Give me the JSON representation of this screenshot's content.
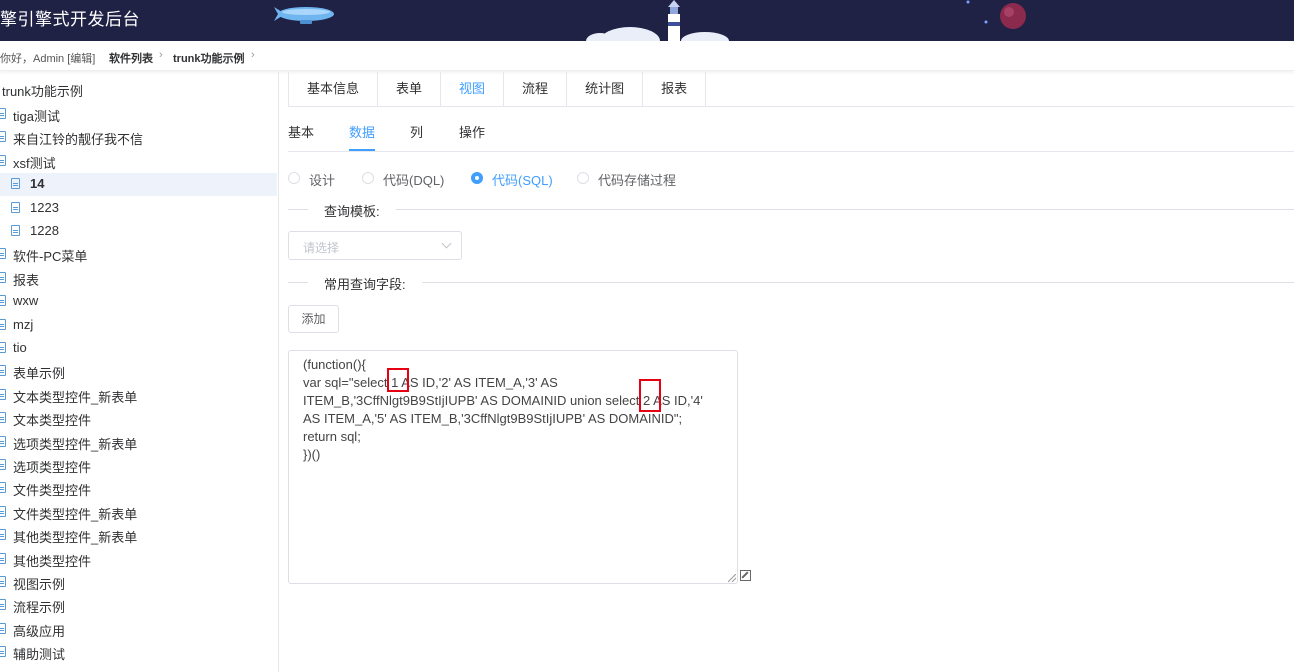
{
  "header": {
    "title": "擎引擎式开发后台"
  },
  "breadcrumb": {
    "greeting": "你好，Admin [编辑]",
    "items": [
      "软件列表",
      "trunk功能示例"
    ]
  },
  "sidebar": {
    "root": "trunk功能示例",
    "items": [
      {
        "label": "tiga测试"
      },
      {
        "label": "来自江铃的靓仔我不信"
      },
      {
        "label": "xsf测试"
      },
      {
        "label": "14"
      },
      {
        "label": "1223"
      },
      {
        "label": "1228"
      },
      {
        "label": "软件-PC菜单"
      },
      {
        "label": "报表"
      },
      {
        "label": "wxw"
      },
      {
        "label": "mzj"
      },
      {
        "label": "tio"
      },
      {
        "label": "表单示例"
      },
      {
        "label": "文本类型控件_新表单"
      },
      {
        "label": "文本类型控件"
      },
      {
        "label": "选项类型控件_新表单"
      },
      {
        "label": "选项类型控件"
      },
      {
        "label": "文件类型控件"
      },
      {
        "label": "文件类型控件_新表单"
      },
      {
        "label": "其他类型控件_新表单"
      },
      {
        "label": "其他类型控件"
      },
      {
        "label": "视图示例"
      },
      {
        "label": "流程示例"
      },
      {
        "label": "高级应用"
      },
      {
        "label": "辅助测试"
      }
    ]
  },
  "tabs": {
    "primary": [
      "基本信息",
      "表单",
      "视图",
      "流程",
      "统计图",
      "报表"
    ],
    "primary_active": "视图",
    "secondary": [
      "基本",
      "数据",
      "列",
      "操作"
    ],
    "secondary_active": "数据"
  },
  "mode": {
    "options": [
      "设计",
      "代码(DQL)",
      "代码(SQL)",
      "代码存储过程"
    ],
    "selected": "代码(SQL)"
  },
  "query_template": {
    "label": "查询模板:",
    "placeholder": "请选择"
  },
  "common_fields": {
    "label": "常用查询字段:",
    "add_label": "添加"
  },
  "code_editor": {
    "lines": [
      "(function(){",
      "var sql=\"select 1 AS ID,'2' AS ITEM_A,'3' AS",
      "ITEM_B,'3CffNlgt9B9StIjIUPB' AS DOMAINID union select 2 AS ID,'4'",
      "AS ITEM_A,'5' AS ITEM_B,'3CffNlgt9B9StIjIUPB' AS DOMAINID\";",
      "return sql;",
      "})()"
    ]
  },
  "colors": {
    "accent": "#409eff",
    "header_bg": "#1f2145",
    "highlight_box": "#e60012"
  }
}
